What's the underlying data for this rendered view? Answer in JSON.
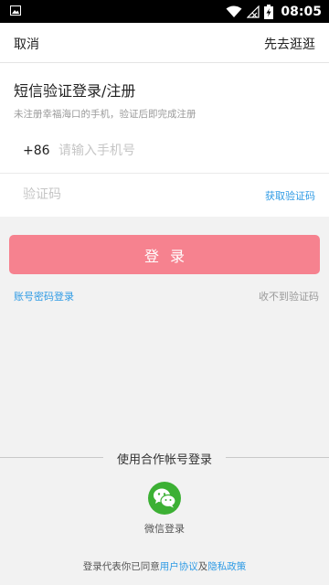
{
  "status_bar": {
    "time": "08:05"
  },
  "top_bar": {
    "cancel_label": "取消",
    "browse_label": "先去逛逛"
  },
  "heading": {
    "title": "短信验证登录/注册",
    "subtitle": "未注册幸福海口的手机，验证后即完成注册"
  },
  "form": {
    "country_code": "+86",
    "phone_placeholder": "请输入手机号",
    "code_placeholder": "验证码",
    "get_code_label": "获取验证码"
  },
  "login_button_label": "登录",
  "links": {
    "password_login": "账号密码登录",
    "no_code": "收不到验证码"
  },
  "third_party": {
    "title": "使用合作帐号登录",
    "wechat_label": "微信登录"
  },
  "agreement": {
    "prefix": "登录代表你已同意",
    "user_agreement": "用户协议",
    "and": "及",
    "privacy_policy": "隐私政策"
  },
  "colors": {
    "accent": "#f6828f",
    "link": "#2f9be5",
    "wechat": "#3cb034"
  }
}
